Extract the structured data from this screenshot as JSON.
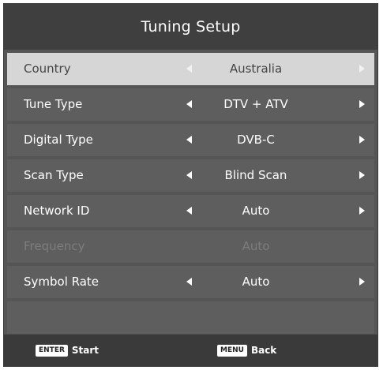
{
  "header": {
    "title": "Tuning Setup"
  },
  "settings": [
    {
      "label": "Country",
      "value": "Australia",
      "state": "selected"
    },
    {
      "label": "Tune Type",
      "value": "DTV + ATV",
      "state": "normal"
    },
    {
      "label": "Digital Type",
      "value": "DVB-C",
      "state": "normal"
    },
    {
      "label": "Scan Type",
      "value": "Blind Scan",
      "state": "normal"
    },
    {
      "label": "Network ID",
      "value": "Auto",
      "state": "normal"
    },
    {
      "label": "Frequency",
      "value": "Auto",
      "state": "disabled"
    },
    {
      "label": "Symbol Rate",
      "value": "Auto",
      "state": "normal"
    }
  ],
  "footer": {
    "start_key": "ENTER",
    "start_label": "Start",
    "back_key": "MENU",
    "back_label": "Back"
  },
  "icons": {
    "left": "triangle-left-icon",
    "right": "triangle-right-icon"
  },
  "colors": {
    "panel": "#555555",
    "header": "#3f3f3f",
    "row": "#5e5e5e",
    "selected_row": "#d6d6d6",
    "disabled_text": "#7d7d7d"
  }
}
